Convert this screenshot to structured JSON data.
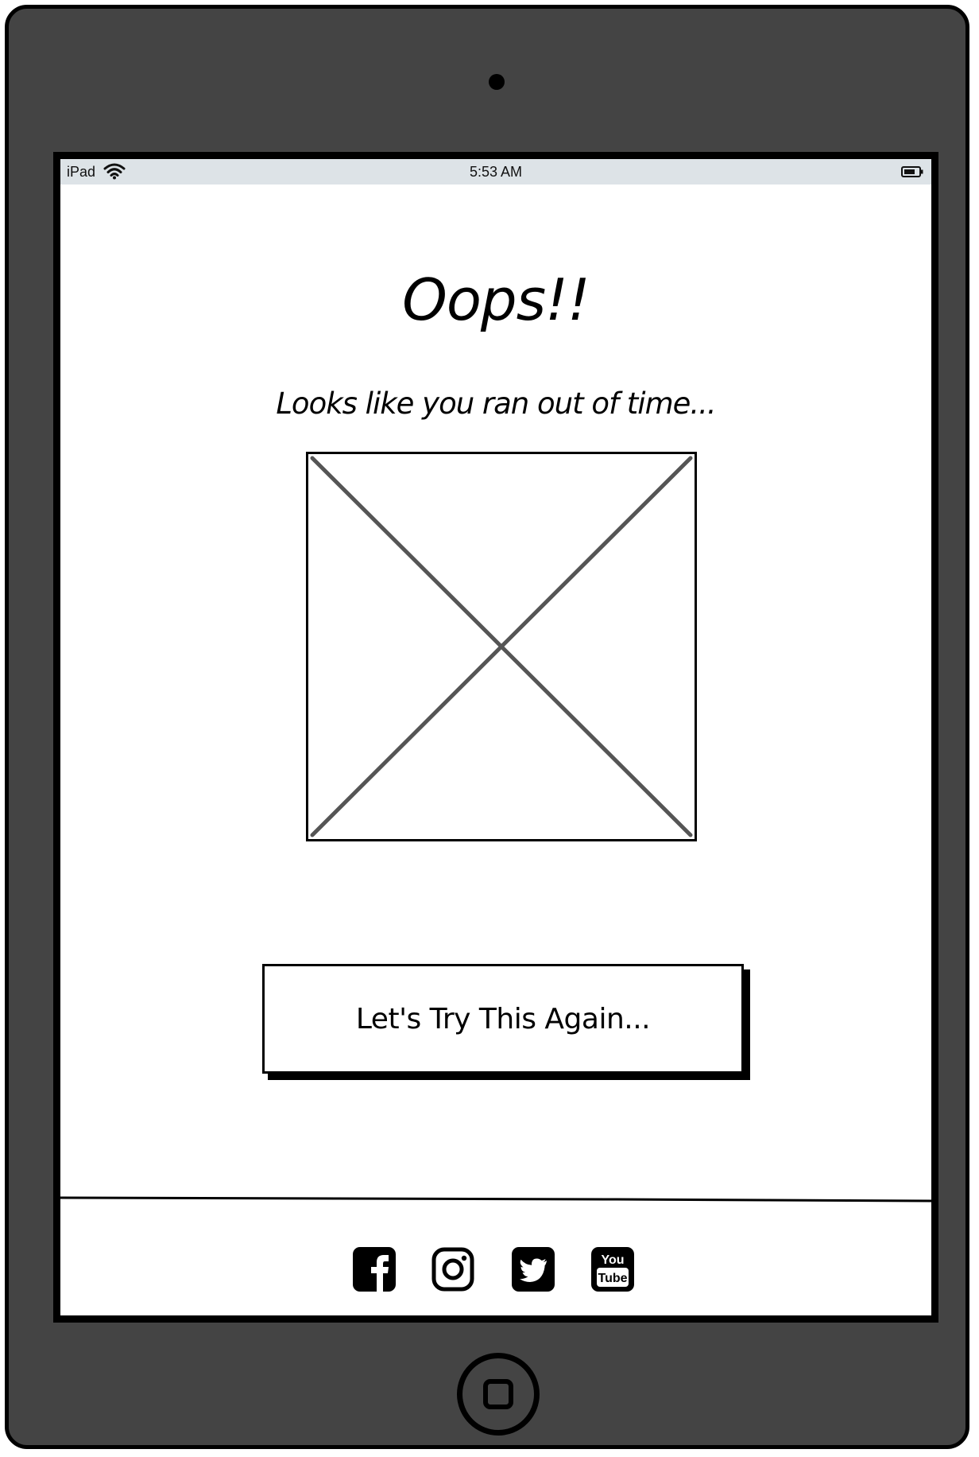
{
  "status_bar": {
    "device": "iPad",
    "time": "5:53 AM",
    "wifi_icon": "wifi-icon",
    "battery_icon": "battery-icon"
  },
  "main": {
    "title": "Oops!!",
    "subtitle": "Looks like you ran out of time...",
    "image_placeholder_icon": "image-placeholder",
    "retry_label": "Let's Try This Again..."
  },
  "footer": {
    "social": [
      {
        "name": "facebook",
        "icon": "facebook-icon"
      },
      {
        "name": "instagram",
        "icon": "instagram-icon"
      },
      {
        "name": "twitter",
        "icon": "twitter-icon"
      },
      {
        "name": "youtube",
        "icon": "youtube-icon",
        "text_top": "You",
        "text_bottom": "Tube"
      }
    ]
  },
  "colors": {
    "frame": "#444444",
    "status_bar": "#dde3e7",
    "placeholder_cross": "#555555"
  }
}
